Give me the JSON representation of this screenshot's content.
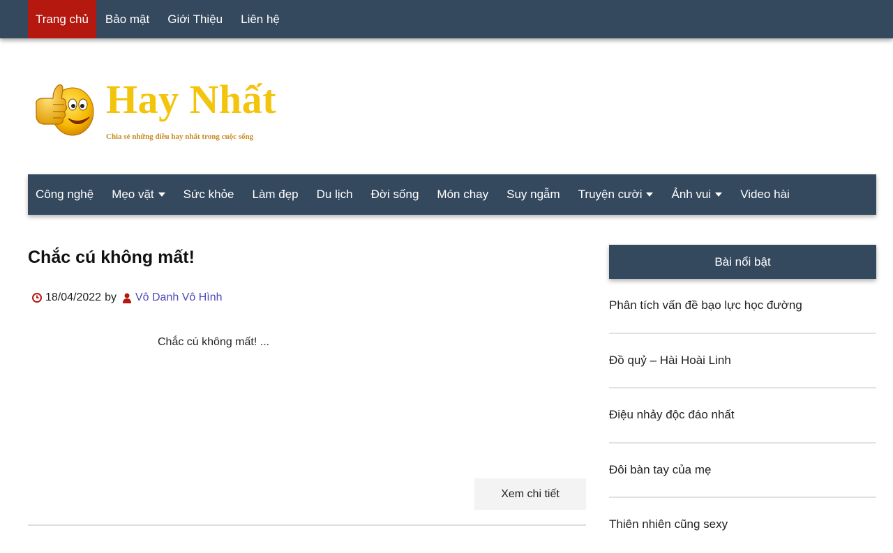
{
  "topnav": {
    "items": [
      {
        "label": "Trang chủ",
        "active": true
      },
      {
        "label": "Bảo mật"
      },
      {
        "label": "Giới Thiệu"
      },
      {
        "label": "Liên hệ"
      }
    ]
  },
  "logo": {
    "title": "Hay Nhất",
    "subtitle": "Chia sẻ những điều hay nhất trong cuộc sống",
    "icon": "thumbs-up-smiley-icon"
  },
  "mainnav": {
    "items": [
      {
        "label": "Công nghệ"
      },
      {
        "label": "Mẹo vặt",
        "dropdown": true
      },
      {
        "label": "Sức khỏe"
      },
      {
        "label": "Làm đẹp"
      },
      {
        "label": "Du lịch"
      },
      {
        "label": "Đời sống"
      },
      {
        "label": "Món chay"
      },
      {
        "label": "Suy ngẫm"
      },
      {
        "label": "Truyện cười",
        "dropdown": true
      },
      {
        "label": "Ảnh vui",
        "dropdown": true
      },
      {
        "label": "Video hài"
      }
    ]
  },
  "post": {
    "title": "Chắc cú không mất!",
    "date": "18/04/2022",
    "by": "by",
    "author": "Vô Danh Vô Hình",
    "excerpt": "Chắc cú không mất! ...",
    "read_more": "Xem chi tiết"
  },
  "sidebar": {
    "title": "Bài nổi bật",
    "items": [
      "Phân tích vấn đề bạo lực học đường",
      "Đồ quỷ – Hài Hoài Linh",
      "Điệu nhảy độc đáo nhất",
      "Đôi bàn tay của mẹ",
      "Thiên nhiên cũng sexy"
    ]
  },
  "colors": {
    "nav_bg": "#34495e",
    "active_bg": "#b5180f",
    "logo_gold": "#f2c40c",
    "author_link": "#4a4ab8",
    "icon_red": "#b5180f"
  }
}
